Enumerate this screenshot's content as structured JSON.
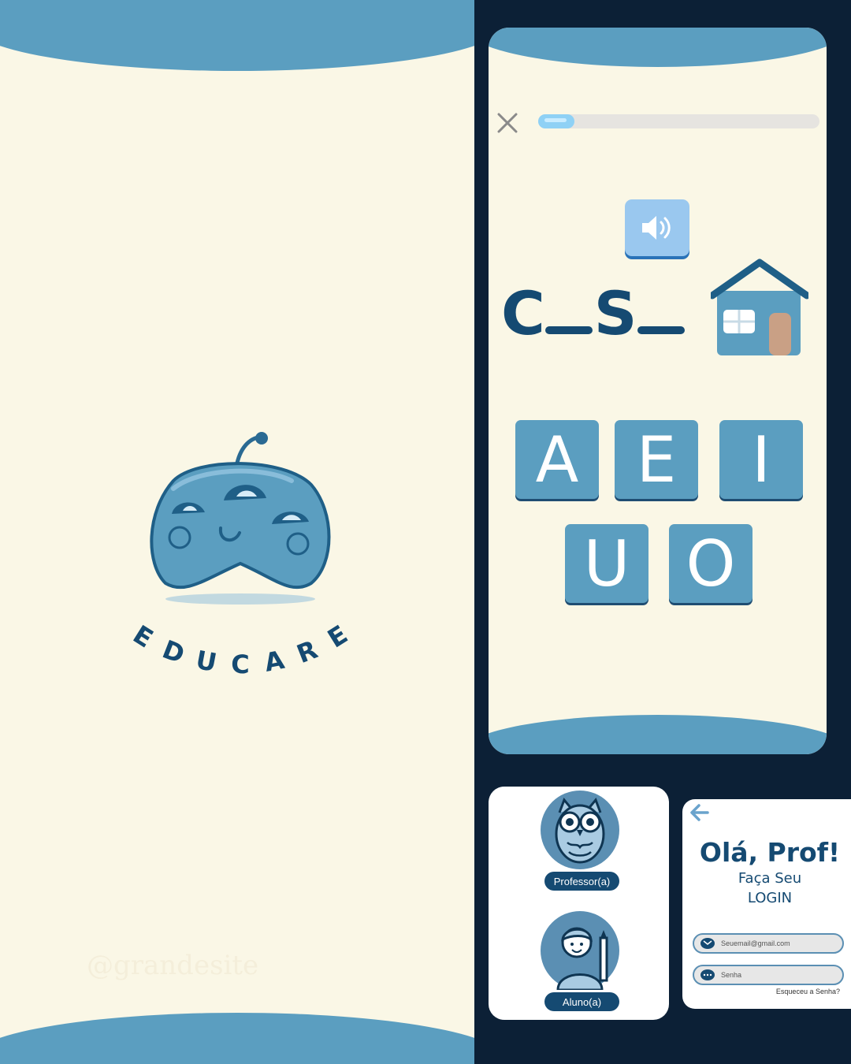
{
  "splash": {
    "brand_letters": [
      "E",
      "D",
      "U",
      "C",
      "A",
      "R",
      "E"
    ],
    "watermark": "@grandesite",
    "colors": {
      "background": "#faf7e6",
      "wave": "#5b9ec0",
      "mascot": "#5b9ec0",
      "brand_text": "#154a72"
    }
  },
  "quiz": {
    "close_icon": "close-icon",
    "progress_fraction": 0.13,
    "sound_icon": "speaker-icon",
    "word_parts": [
      "C",
      "S"
    ],
    "picture": "house-icon",
    "options": [
      "A",
      "E",
      "I",
      "U",
      "O"
    ],
    "colors": {
      "tile": "#5b9ec0",
      "word": "#154a72",
      "progress": "#8fd1f5",
      "sound_button": "#9ac8ef"
    }
  },
  "roles": {
    "professor_label": "Professor(a)",
    "student_label": "Aluno(a)",
    "professor_icon": "owl-icon",
    "student_icon": "student-icon"
  },
  "login": {
    "back_icon": "arrow-left-icon",
    "title": "Olá, Prof!",
    "subtitle_line1": "Faça Seu",
    "subtitle_line2": "LOGIN",
    "email_placeholder": "Seuemail@gmail.com",
    "password_placeholder": "Senha",
    "forgot_link": "Esqueceu a Senha?"
  }
}
